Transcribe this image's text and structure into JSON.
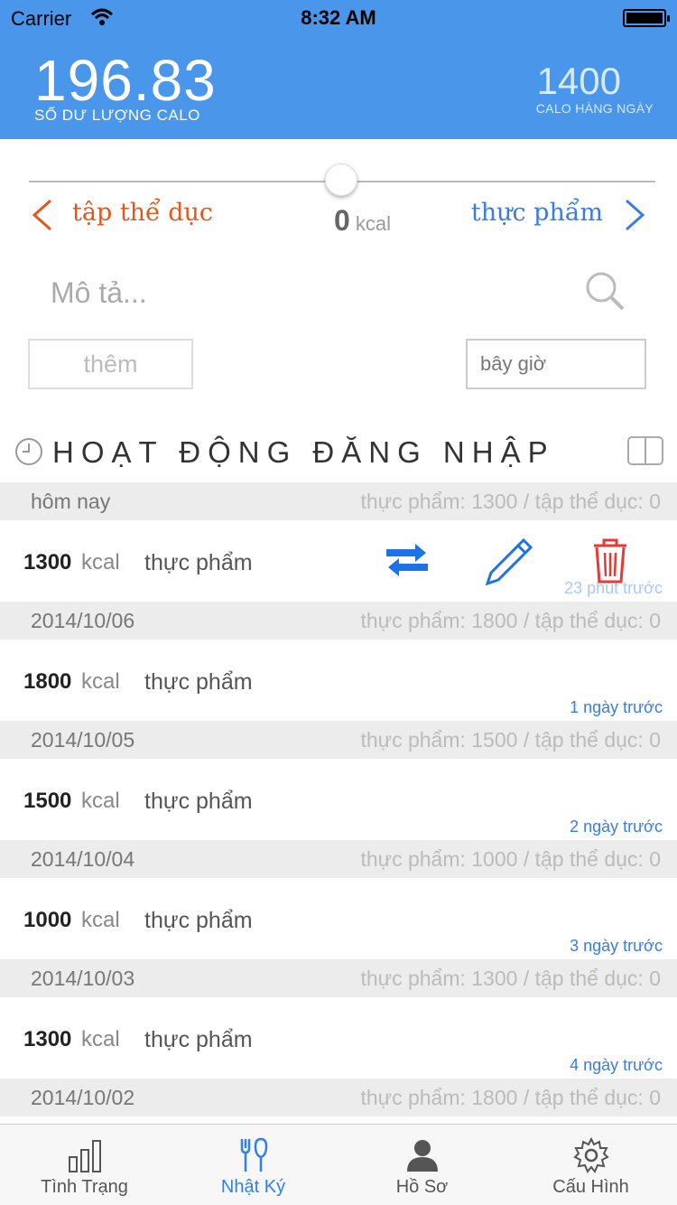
{
  "status_bar": {
    "carrier": "Carrier",
    "time": "8:32 AM"
  },
  "header": {
    "balance": "196.83",
    "balance_label": "SỐ DƯ LƯỢNG CALO",
    "daily": "1400",
    "daily_label": "CALO HÀNG NGÀY",
    "color": "#4a96ea"
  },
  "entry_form": {
    "slider_value": 0,
    "exercise_label": "tập thể dục",
    "food_label": "thực phẩm",
    "kcal_value": "0",
    "kcal_unit": "kcal",
    "description_placeholder": "Mô tả...",
    "add_label": "thêm",
    "time_value": "bây giờ",
    "exercise_color": "#e2571e",
    "food_color": "#3a7ce6"
  },
  "log": {
    "title": "HOẠT ĐỘNG ĐĂNG NHẬP",
    "days": [
      {
        "date": "hôm nay",
        "summary": "thực phẩm: 1300 / tập thể dục: 0",
        "entry": {
          "kcal": "1300",
          "unit": "kcal",
          "type": "thực phẩm",
          "ago": "23 phút trước"
        }
      },
      {
        "date": "2014/10/06",
        "summary": "thực phẩm: 1800 / tập thể dục: 0",
        "entry": {
          "kcal": "1800",
          "unit": "kcal",
          "type": "thực phẩm",
          "ago": "1 ngày trước"
        }
      },
      {
        "date": "2014/10/05",
        "summary": "thực phẩm: 1500 / tập thể dục: 0",
        "entry": {
          "kcal": "1500",
          "unit": "kcal",
          "type": "thực phẩm",
          "ago": "2 ngày trước"
        }
      },
      {
        "date": "2014/10/04",
        "summary": "thực phẩm: 1000 / tập thể dục: 0",
        "entry": {
          "kcal": "1000",
          "unit": "kcal",
          "type": "thực phẩm",
          "ago": "3 ngày trước"
        }
      },
      {
        "date": "2014/10/03",
        "summary": "thực phẩm: 1300 / tập thể dục: 0",
        "entry": {
          "kcal": "1300",
          "unit": "kcal",
          "type": "thực phẩm",
          "ago": "4 ngày trước"
        }
      },
      {
        "date": "2014/10/02",
        "summary": "thực phẩm: 1800 / tập thể dục: 0"
      }
    ],
    "action_icons": [
      "repeat-icon",
      "pencil-icon",
      "trash-icon"
    ]
  },
  "tabbar": {
    "tabs": [
      {
        "label": "Tình Trạng",
        "icon": "bar-chart-icon"
      },
      {
        "label": "Nhật Ký",
        "icon": "fork-knife-icon",
        "active": true
      },
      {
        "label": "Hồ Sơ",
        "icon": "person-icon"
      },
      {
        "label": "Cấu Hình",
        "icon": "gear-icon"
      }
    ],
    "active_color": "#2f7ff0"
  }
}
